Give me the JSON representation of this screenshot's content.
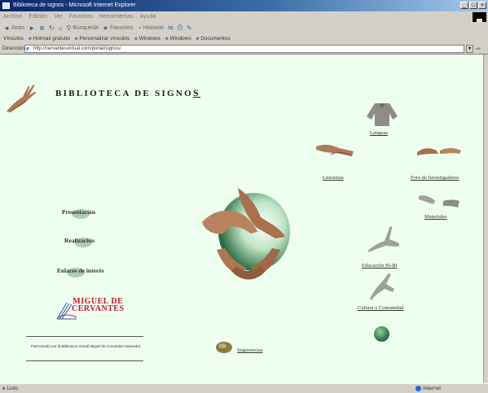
{
  "window": {
    "title": "Biblioteca de signos - Microsoft Internet Explorer",
    "controls": [
      "_",
      "□",
      "×"
    ]
  },
  "menubar": {
    "items": [
      "Archivo",
      "Edición",
      "Ver",
      "Favoritos",
      "Herramientas",
      "Ayuda"
    ]
  },
  "toolbar": {
    "back": "Atrás",
    "search": "Búsqueda",
    "favorites": "Favoritos",
    "history": "Historial"
  },
  "linksbar": {
    "label": "Vínculos",
    "items": [
      "Hotmail gratuito",
      "Personalizar vínculos",
      "Windows",
      "Windows",
      "Documentos"
    ]
  },
  "addressbar": {
    "label": "Dirección",
    "url": "http://cervantesvirtual.com/portal/signos/",
    "go_label": "Ir"
  },
  "page": {
    "title_main": "BIBLIOTECA DE SIGNO",
    "title_last": "S",
    "left_menu": {
      "presentacion": "Presentación",
      "realizacion": "Realización",
      "enlaces": "Enlaces de interés"
    },
    "logo": {
      "line1": "MIGUEL DE",
      "line2": "CERVANTES"
    },
    "credits": "Patrocinado por la Biblioteca Virtual Miguel de Cervantes Saavedra",
    "right_links": {
      "lenguas": "Lenguas",
      "literatura": "Literatura",
      "foro": "Foro de Investigadores",
      "materiales": "Materiales",
      "educacion": "Educación Bi-Bi",
      "cultura": "Cultura y Comunidad",
      "sugerencias": "Sugerencias"
    }
  },
  "status": {
    "left": "Listo",
    "zone": "Internet"
  },
  "colors": {
    "page_bg": "#eefff0",
    "title_bar": "#0a246a",
    "logo_red": "#c01a2a"
  }
}
